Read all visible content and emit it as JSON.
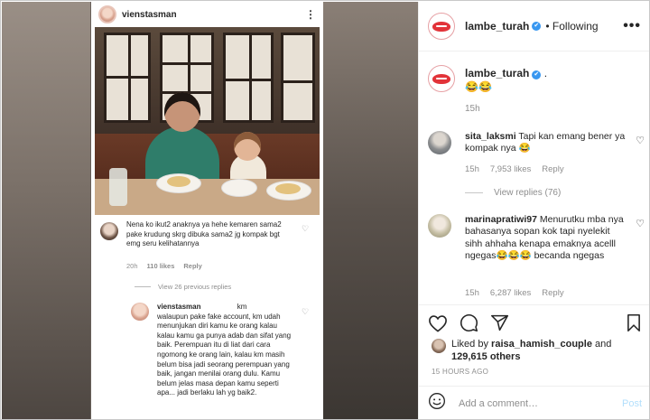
{
  "embedded_post": {
    "username": "vienstasman",
    "comment1": {
      "text": "Nena ko ikut2 anaknya ya hehe kemaren sama2 pake krudung skrg dibuka sama2 jg kompak bgt emg seru kelihatannya",
      "time": "20h",
      "likes": "110 likes",
      "reply": "Reply"
    },
    "view_replies": "View 26 previous replies",
    "reply": {
      "username": "vienstasman",
      "text_prefix": "km",
      "text": "walaupun pake fake account, km udah menunjukan diri kamu ke orang kalau kalau kamu ga punya adab dan sifat yang baik. Perempuan itu di liat dari cara ngomong ke orang lain, kalau km masih belum bisa jadi seorang perempuan yang baik, jangan menilai orang dulu. Kamu belum jelas masa depan kamu seperti apa... jadi berlaku lah yg baik2."
    }
  },
  "header": {
    "username": "lambe_turah",
    "verified_glyph": "✔",
    "separator": "•",
    "following": "Following",
    "more": "•••"
  },
  "caption": {
    "username": "lambe_turah",
    "text": ". ",
    "emoji": "😂😂",
    "time": "15h"
  },
  "comments": [
    {
      "username": "sita_laksmi",
      "text": "Tapi kan emang bener ya kompak nya 😂",
      "time": "15h",
      "likes": "7,953 likes",
      "reply": "Reply",
      "view_replies": "View replies (76)"
    },
    {
      "username": "marinapratiwi97",
      "text": "Menurutku mba nya bahasanya sopan kok tapi nyelekit sihh ahhaha kenapa emaknya acelll ngegas😂😂😂 becanda ngegas",
      "time": "15h",
      "likes": "6,287 likes",
      "reply": "Reply"
    }
  ],
  "likes": {
    "prefix": "Liked by",
    "user": "raisa_hamish_couple",
    "and": "and",
    "count": "129,615 others"
  },
  "posted_ago": "15 HOURS AGO",
  "comment_box": {
    "placeholder": "Add a comment…",
    "post": "Post"
  },
  "colors": {
    "verified": "#3897f0",
    "brand_lips": "#e23339",
    "muted_text": "#8e8e8e",
    "post_disabled": "#b2dffc"
  },
  "icons": [
    "heart-icon",
    "comment-icon",
    "share-icon",
    "bookmark-icon",
    "emoji-icon",
    "more-icon",
    "verified-icon"
  ]
}
